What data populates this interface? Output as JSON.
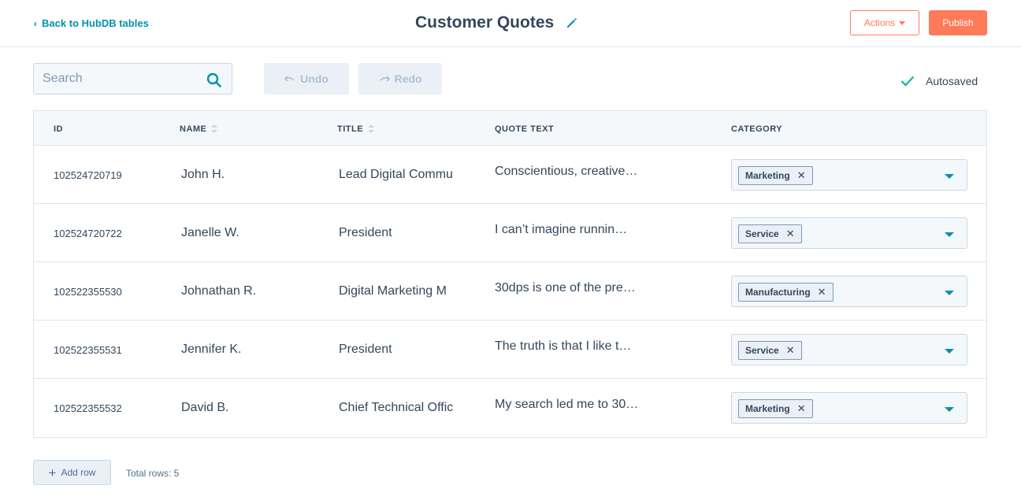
{
  "header": {
    "back_label": "Back to HubDB tables",
    "title": "Customer Quotes",
    "actions_label": "Actions",
    "publish_label": "Publish"
  },
  "toolbar": {
    "search_placeholder": "Search",
    "undo_label": "Undo",
    "redo_label": "Redo",
    "autosaved_label": "Autosaved"
  },
  "table": {
    "columns": [
      "ID",
      "NAME",
      "TITLE",
      "QUOTE TEXT",
      "CATEGORY"
    ],
    "rows": [
      {
        "id": "102524720719",
        "name": "John H.",
        "title": "Lead Digital Commu",
        "quote": "Conscientious, creative…",
        "category": "Marketing"
      },
      {
        "id": "102524720722",
        "name": "Janelle W.",
        "title": "President",
        "quote": "I can’t imagine runnin…",
        "category": "Service"
      },
      {
        "id": "102522355530",
        "name": "Johnathan R.",
        "title": "Digital Marketing M",
        "quote": "30dps is one of the pre…",
        "category": "Manufacturing"
      },
      {
        "id": "102522355531",
        "name": "Jennifer K.",
        "title": "President",
        "quote": "The truth is that I like t…",
        "category": "Service"
      },
      {
        "id": "102522355532",
        "name": "David B.",
        "title": "Chief Technical Offic",
        "quote": "My search led me to 30…",
        "category": "Marketing"
      }
    ]
  },
  "footer": {
    "add_row_label": "Add row",
    "total_rows_label": "Total rows: 5"
  },
  "colors": {
    "accent": "#ff7a59",
    "link": "#0091ae",
    "text": "#33475b",
    "check": "#00bda5"
  },
  "icons": {
    "back": "chevron-left-icon",
    "edit": "pencil-icon",
    "search": "search-icon",
    "undo": "undo-icon",
    "redo": "redo-icon",
    "autosaved": "check-icon",
    "add": "plus-icon",
    "tag_remove": "close-icon",
    "dropdown": "caret-down-icon",
    "sort": "sort-icon"
  }
}
